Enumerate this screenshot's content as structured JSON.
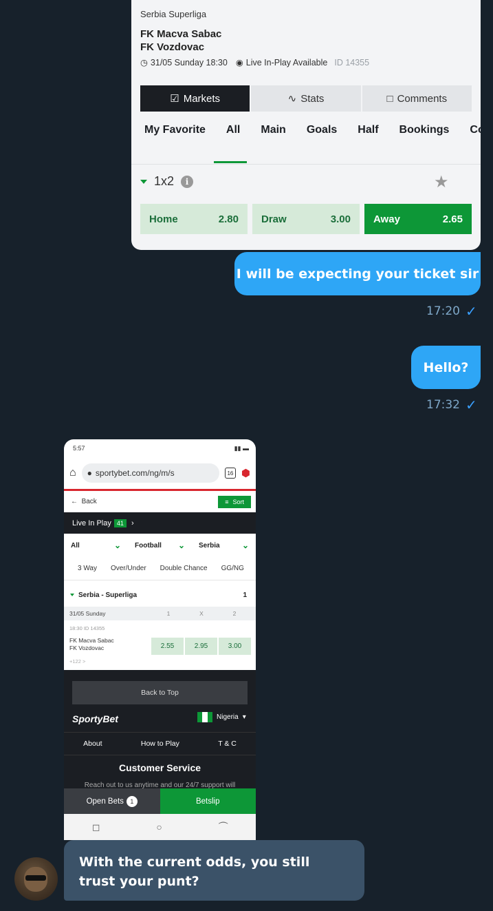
{
  "card1": {
    "league": "Serbia Superliga",
    "home_team": "FK Macva Sabac",
    "away_team": "FK Vozdovac",
    "datetime": "31/05 Sunday 18:30",
    "live_text": "Live In-Play Available",
    "match_id": "ID 14355",
    "top_tabs": [
      "Markets",
      "Stats",
      "Comments"
    ],
    "market_tabs": [
      "My Favorite",
      "All",
      "Main",
      "Goals",
      "Half",
      "Bookings",
      "Corr"
    ],
    "market_name": "1x2",
    "odds": [
      {
        "name": "Home",
        "value": "2.80"
      },
      {
        "name": "Draw",
        "value": "3.00"
      },
      {
        "name": "Away",
        "value": "2.65"
      }
    ]
  },
  "messages": {
    "msg1": "I will be expecting your ticket sir",
    "msg1_time": "17:20",
    "msg2": "Hello?",
    "msg2_time": "17:32",
    "msg3": "With the current odds, you still trust your punt?",
    "tick": "✓"
  },
  "phone": {
    "status_time": "5:57",
    "url": "sportybet.com/ng/m/s",
    "tab_count": "16",
    "back": "Back",
    "sort": "Sort",
    "live_in_play": "Live In Play",
    "live_count": "41",
    "filters": [
      "All",
      "Football",
      "Serbia"
    ],
    "market_tabs": [
      "3 Way",
      "Over/Under",
      "Double Chance",
      "GG/NG"
    ],
    "league": "Serbia - Superliga",
    "league_count": "1",
    "date": "31/05 Sunday",
    "cols": [
      "1",
      "X",
      "2"
    ],
    "kickoff": "18:30   ID 14355",
    "home": "FK Macva Sabac",
    "away": "FK Vozdovac",
    "odds": [
      "2.55",
      "2.95",
      "3.00"
    ],
    "more": "+122 >",
    "back_to_top": "Back to Top",
    "brand": "SportyBet",
    "country": "Nigeria",
    "links": [
      "About",
      "How to Play",
      "T & C"
    ],
    "customer_service": "Customer Service",
    "cs_sub": "Reach out to us anytime and our 24/7 support will",
    "open_bets": "Open Bets",
    "open_bets_count": "1",
    "betslip": "Betslip"
  },
  "colors": {
    "chat_bg": "#17212b",
    "outgoing": "#2ea6f6",
    "incoming": "#3b5268",
    "sporty_green": "#0d9737"
  }
}
